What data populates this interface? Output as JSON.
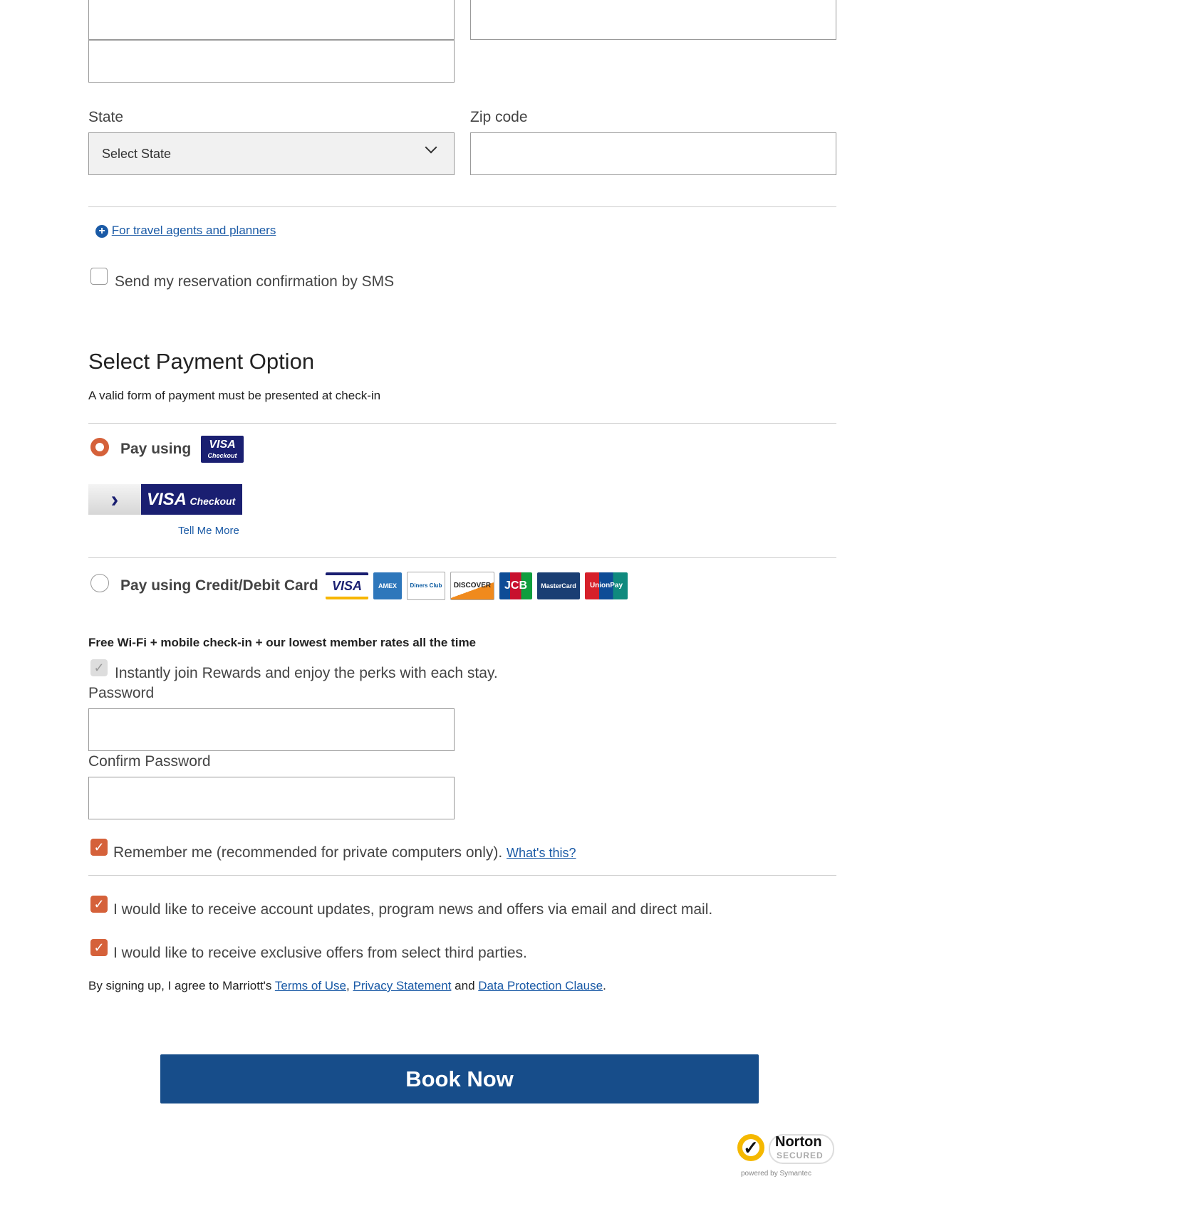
{
  "address": {
    "state_label": "State",
    "state_value": "Select State",
    "zip_label": "Zip code"
  },
  "travel_agents_link": "For travel agents and planners",
  "sms_label": "Send my reservation confirmation by SMS",
  "payment": {
    "title": "Select Payment Option",
    "subtitle": "A valid form of payment must be presented at check-in",
    "option_visa_label": "Pay using",
    "visa_badge": "VISA",
    "visa_badge_sub": "Checkout",
    "visa_checkout_button": "VISA",
    "visa_checkout_button_sub": "Checkout",
    "tell_me_more": "Tell Me More",
    "option_card_label": "Pay using Credit/Debit Card",
    "selected_option": "visa-checkout",
    "cards": [
      "VISA",
      "AMEX",
      "Diners Club",
      "DISCOVER",
      "JCB",
      "MasterCard",
      "UnionPay"
    ]
  },
  "rewards": {
    "headline": "Free Wi-Fi + mobile check-in + our lowest member rates all the time",
    "join_label": "Instantly join Rewards and enjoy the perks with each stay.",
    "password_label": "Password",
    "confirm_password_label": "Confirm Password",
    "remember_label": "Remember me (recommended for private computers only).",
    "whats_this": "What's this?",
    "updates_label": "I would like to receive account updates, program news and offers via email and direct mail.",
    "third_party_label": "I would like to receive exclusive offers from select third parties.",
    "terms_prefix": "By signing up, I agree to Marriott's",
    "terms_of_use": "Terms of Use",
    "comma": ",",
    "privacy": "Privacy Statement",
    "and": "and",
    "data_protection": "Data Protection Clause",
    "period": "."
  },
  "book_now": "Book Now",
  "norton": {
    "brand": "Norton",
    "secured": "SECURED",
    "powered": "powered by Symantec"
  },
  "colors": {
    "accent": "#d5613a",
    "primary": "#174d8a",
    "link": "#1a5aa6",
    "visa": "#1a1f71"
  }
}
